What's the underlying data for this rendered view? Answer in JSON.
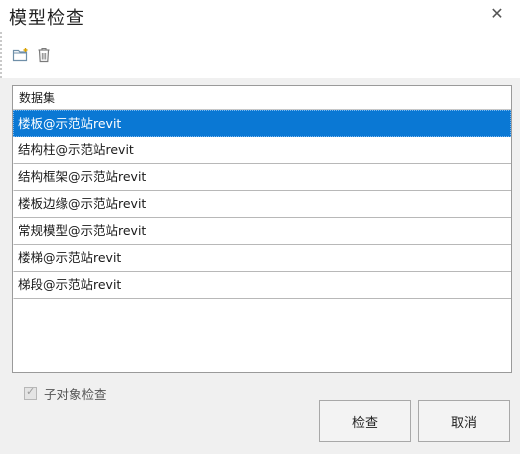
{
  "window": {
    "title": "模型检查",
    "close_glyph": "✕"
  },
  "toolbar": {
    "buttons": [
      {
        "icon": "add-folder-icon"
      },
      {
        "icon": "trash-icon"
      }
    ]
  },
  "list": {
    "header": "数据集",
    "selected_index": 0,
    "items": [
      "楼板@示范站revit",
      "结构柱@示范站revit",
      "结构框架@示范站revit",
      "楼板边缘@示范站revit",
      "常规模型@示范站revit",
      "楼梯@示范站revit",
      "梯段@示范站revit"
    ]
  },
  "footer": {
    "sub_object_check_label": "子对象检查",
    "sub_object_check_checked": true,
    "check_button": "检查",
    "cancel_button": "取消"
  },
  "colors": {
    "selection": "#0a78d4",
    "dialog_bg": "#f0f0f0"
  }
}
